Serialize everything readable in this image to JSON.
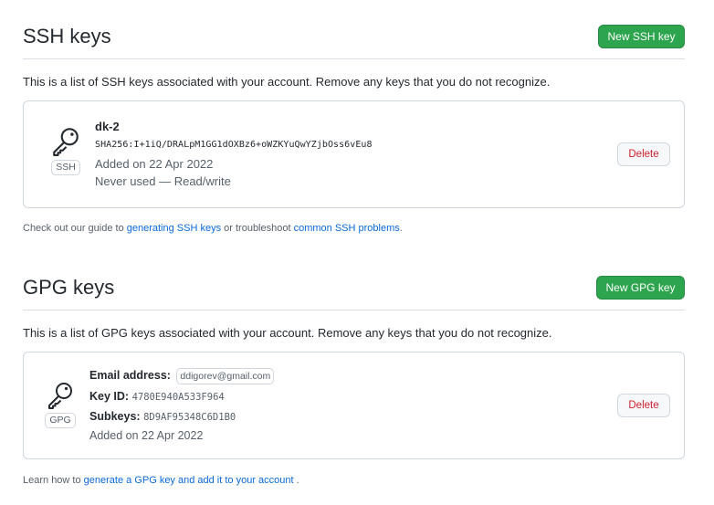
{
  "ssh": {
    "title": "SSH keys",
    "new_button": "New SSH key",
    "intro": "This is a list of SSH keys associated with your account. Remove any keys that you do not recognize.",
    "key": {
      "badge": "SSH",
      "name": "dk-2",
      "fingerprint": "SHA256:I+1iQ/DRALpM1GG1dOXBz6+oWZKYuQwYZjbOss6vEu8",
      "added": "Added on 22 Apr 2022",
      "usage": "Never used — Read/write",
      "delete_label": "Delete"
    },
    "footnote": {
      "prefix": "Check out our guide to ",
      "link1": "generating SSH keys",
      "middle": " or troubleshoot ",
      "link2": "common SSH problems",
      "suffix": "."
    }
  },
  "gpg": {
    "title": "GPG keys",
    "new_button": "New GPG key",
    "intro": "This is a list of GPG keys associated with your account. Remove any keys that you do not recognize.",
    "key": {
      "badge": "GPG",
      "email_label": "Email address:",
      "email": "ddigorev@gmail.com",
      "keyid_label": "Key ID:",
      "keyid": "4780E940A533F964",
      "subkeys_label": "Subkeys:",
      "subkeys": "8D9AF95348C6D1B0",
      "added": "Added on 22 Apr 2022",
      "delete_label": "Delete"
    },
    "footnote": {
      "prefix": "Learn how to ",
      "link": "generate a GPG key and add it to your account",
      "suffix": " ."
    }
  },
  "icons": {
    "ssh_icon": "key-icon",
    "gpg_icon": "key-icon"
  },
  "colors": {
    "primary_button": "#2da44e",
    "danger_text": "#cf222e",
    "link": "#0969da"
  }
}
